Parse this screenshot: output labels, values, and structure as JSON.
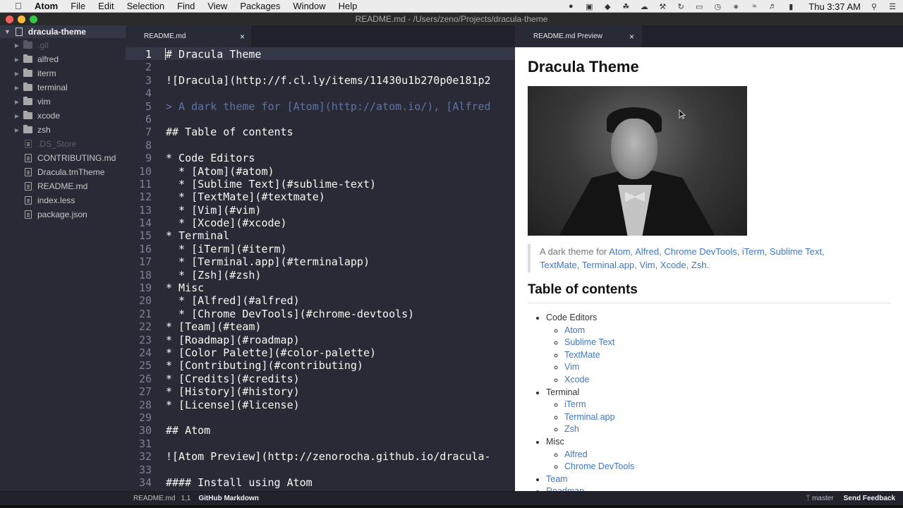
{
  "menubar": {
    "app": "Atom",
    "items": [
      "File",
      "Edit",
      "Selection",
      "Find",
      "View",
      "Packages",
      "Window",
      "Help"
    ],
    "clock": "Thu 3:37 AM"
  },
  "window": {
    "title": "README.md - /Users/zeno/Projects/dracula-theme",
    "colors": {
      "close": "#fc605c",
      "minimize": "#fdbc40",
      "zoom": "#34c84a"
    }
  },
  "tree": {
    "root": "dracula-theme",
    "items": [
      {
        "label": ".git",
        "type": "folder",
        "dim": true
      },
      {
        "label": "alfred",
        "type": "folder",
        "dim": false
      },
      {
        "label": "iterm",
        "type": "folder",
        "dim": false
      },
      {
        "label": "terminal",
        "type": "folder",
        "dim": false
      },
      {
        "label": "vim",
        "type": "folder",
        "dim": false
      },
      {
        "label": "xcode",
        "type": "folder",
        "dim": false
      },
      {
        "label": "zsh",
        "type": "folder",
        "dim": false
      },
      {
        "label": ".DS_Store",
        "type": "file",
        "dim": true
      },
      {
        "label": "CONTRIBUTING.md",
        "type": "file",
        "dim": false
      },
      {
        "label": "Dracula.tmTheme",
        "type": "file",
        "dim": false
      },
      {
        "label": "README.md",
        "type": "file",
        "dim": false
      },
      {
        "label": "index.less",
        "type": "file",
        "dim": false
      },
      {
        "label": "package.json",
        "type": "file",
        "dim": false
      }
    ]
  },
  "editor": {
    "tab_label": "README.md",
    "close_glyph": "×",
    "current_line": 1,
    "lines": [
      {
        "n": "1",
        "text": "# Dracula Theme"
      },
      {
        "n": "2",
        "text": ""
      },
      {
        "n": "3",
        "text": "![Dracula](http://f.cl.ly/items/11430u1b270p0e181p2"
      },
      {
        "n": "4",
        "text": ""
      },
      {
        "n": "5",
        "text": "> A dark theme for [Atom](http://atom.io/), [Alfred",
        "quote": true
      },
      {
        "n": "6",
        "text": ""
      },
      {
        "n": "7",
        "text": "## Table of contents"
      },
      {
        "n": "8",
        "text": ""
      },
      {
        "n": "9",
        "text": "* Code Editors"
      },
      {
        "n": "10",
        "text": "  * [Atom](#atom)"
      },
      {
        "n": "11",
        "text": "  * [Sublime Text](#sublime-text)"
      },
      {
        "n": "12",
        "text": "  * [TextMate](#textmate)"
      },
      {
        "n": "13",
        "text": "  * [Vim](#vim)"
      },
      {
        "n": "14",
        "text": "  * [Xcode](#xcode)"
      },
      {
        "n": "15",
        "text": "* Terminal"
      },
      {
        "n": "16",
        "text": "  * [iTerm](#iterm)"
      },
      {
        "n": "17",
        "text": "  * [Terminal.app](#terminalapp)"
      },
      {
        "n": "18",
        "text": "  * [Zsh](#zsh)"
      },
      {
        "n": "19",
        "text": "* Misc"
      },
      {
        "n": "20",
        "text": "  * [Alfred](#alfred)"
      },
      {
        "n": "21",
        "text": "  * [Chrome DevTools](#chrome-devtools)"
      },
      {
        "n": "22",
        "text": "* [Team](#team)"
      },
      {
        "n": "23",
        "text": "* [Roadmap](#roadmap)"
      },
      {
        "n": "24",
        "text": "* [Color Palette](#color-palette)"
      },
      {
        "n": "25",
        "text": "* [Contributing](#contributing)"
      },
      {
        "n": "26",
        "text": "* [Credits](#credits)"
      },
      {
        "n": "27",
        "text": "* [History](#history)"
      },
      {
        "n": "28",
        "text": "* [License](#license)"
      },
      {
        "n": "29",
        "text": ""
      },
      {
        "n": "30",
        "text": "## Atom"
      },
      {
        "n": "31",
        "text": ""
      },
      {
        "n": "32",
        "text": "![Atom Preview](http://zenorocha.github.io/dracula-"
      },
      {
        "n": "33",
        "text": ""
      },
      {
        "n": "34",
        "text": "#### Install using Atom"
      }
    ]
  },
  "preview": {
    "tab_label": "README.md Preview",
    "close_glyph": "×",
    "title": "Dracula Theme",
    "quote_prefix": "A dark theme for ",
    "quote_links": [
      "Atom",
      "Alfred",
      "Chrome DevTools",
      "iTerm",
      "Sublime Text",
      "TextMate",
      "Terminal.app",
      "Vim",
      "Xcode",
      "Zsh"
    ],
    "quote_suffix": ".",
    "toc_heading": "Table of contents",
    "toc": [
      {
        "label": "Code Editors",
        "link": false,
        "children": [
          "Atom",
          "Sublime Text",
          "TextMate",
          "Vim",
          "Xcode"
        ]
      },
      {
        "label": "Terminal",
        "link": false,
        "children": [
          "iTerm",
          "Terminal.app",
          "Zsh"
        ]
      },
      {
        "label": "Misc",
        "link": false,
        "children": [
          "Alfred",
          "Chrome DevTools"
        ]
      },
      {
        "label": "Team",
        "link": true,
        "children": []
      },
      {
        "label": "Roadmap",
        "link": true,
        "children": []
      }
    ]
  },
  "status": {
    "file": "README.md",
    "cursor": "1,1",
    "grammar": "GitHub Markdown",
    "branch": "master",
    "feedback": "Send Feedback"
  },
  "colors": {
    "background": "#282a36",
    "comment": "#6272a4",
    "foreground": "#f8f8f2",
    "link": "#4078c0"
  }
}
